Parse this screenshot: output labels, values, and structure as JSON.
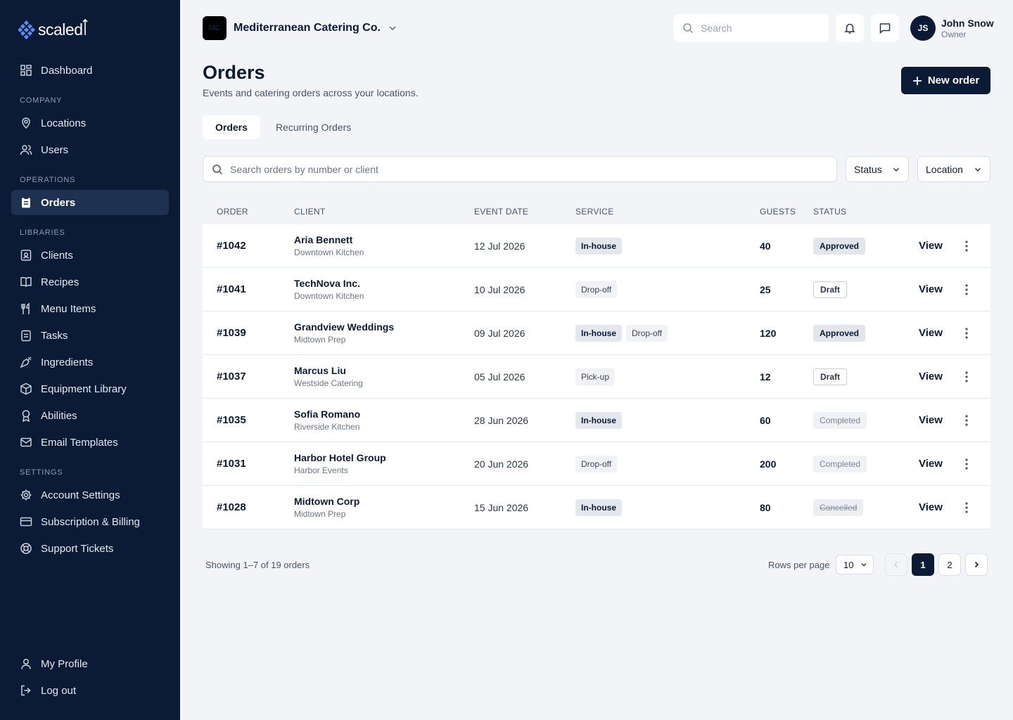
{
  "brand": {
    "name": "scaled"
  },
  "sidebar": {
    "dashboard": "Dashboard",
    "sections": {
      "company": "COMPANY",
      "operations": "OPERATIONS",
      "libraries": "LIBRARIES",
      "settings": "SETTINGS"
    },
    "items": {
      "locations": "Locations",
      "users": "Users",
      "orders": "Orders",
      "clients": "Clients",
      "recipes": "Recipes",
      "menu_items": "Menu Items",
      "tasks": "Tasks",
      "ingredients": "Ingredients",
      "equipment": "Equipment Library",
      "abilities": "Abilities",
      "email_templates": "Email Templates",
      "account_settings": "Account Settings",
      "subscription": "Subscription & Billing",
      "support": "Support Tickets",
      "my_profile": "My Profile",
      "log_out": "Log out"
    },
    "active": "orders"
  },
  "header": {
    "company_initials": "MC",
    "company_name": "Mediterranean Catering Co.",
    "search_placeholder": "Search",
    "user": {
      "initials": "JS",
      "name": "John Snow",
      "role": "Owner"
    }
  },
  "page": {
    "title": "Orders",
    "subtitle": "Events and catering orders across your locations.",
    "new_order_label": "New order",
    "tabs": [
      "Orders",
      "Recurring Orders"
    ],
    "search_placeholder": "Search orders by number or client",
    "filters": {
      "status": "Status",
      "location": "Location"
    }
  },
  "table": {
    "columns": {
      "order": "ORDER",
      "client": "CLIENT",
      "event_date": "EVENT DATE",
      "service": "SERVICE",
      "guests": "GUESTS",
      "status": "STATUS"
    },
    "action_label": "View",
    "rows": [
      {
        "order": "#1042",
        "client": "Aria Bennett",
        "location": "Downtown Kitchen",
        "date": "12 Jul 2026",
        "services": [
          "In-house"
        ],
        "guests": "40",
        "status": "Approved"
      },
      {
        "order": "#1041",
        "client": "TechNova Inc.",
        "location": "Downtown Kitchen",
        "date": "10 Jul 2026",
        "services": [
          "Drop-off"
        ],
        "guests": "25",
        "status": "Draft"
      },
      {
        "order": "#1039",
        "client": "Grandview Weddings",
        "location": "Midtown Prep",
        "date": "09 Jul 2026",
        "services": [
          "In-house",
          "Drop-off"
        ],
        "guests": "120",
        "status": "Approved"
      },
      {
        "order": "#1037",
        "client": "Marcus Liu",
        "location": "Westside Catering",
        "date": "05 Jul 2026",
        "services": [
          "Pick-up"
        ],
        "guests": "12",
        "status": "Draft"
      },
      {
        "order": "#1035",
        "client": "Sofia Romano",
        "location": "Riverside Kitchen",
        "date": "28 Jun 2026",
        "services": [
          "In-house"
        ],
        "guests": "60",
        "status": "Completed"
      },
      {
        "order": "#1031",
        "client": "Harbor Hotel Group",
        "location": "Harbor Events",
        "date": "20 Jun 2026",
        "services": [
          "Drop-off"
        ],
        "guests": "200",
        "status": "Completed"
      },
      {
        "order": "#1028",
        "client": "Midtown Corp",
        "location": "Midtown Prep",
        "date": "15 Jun 2026",
        "services": [
          "In-house"
        ],
        "guests": "80",
        "status": "Cancelled"
      }
    ]
  },
  "pagination": {
    "summary": "Showing 1–7 of 19 orders",
    "rows_per_page_label": "Rows per page",
    "rows_per_page": "10",
    "pages": [
      "1",
      "2"
    ],
    "current_page": "1"
  }
}
